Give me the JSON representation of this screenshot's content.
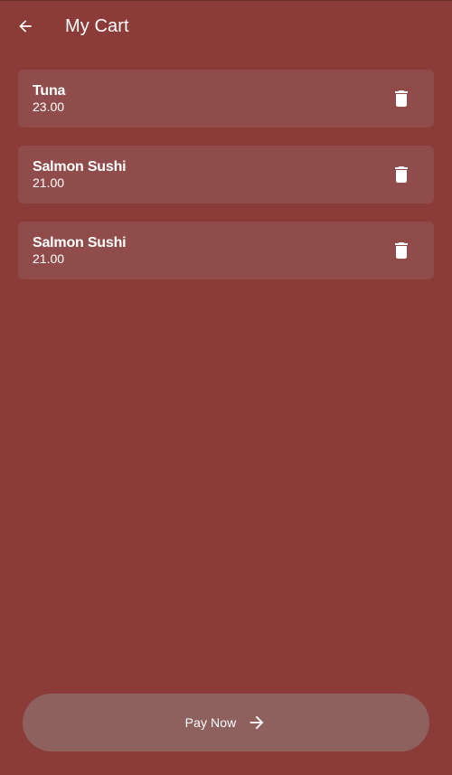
{
  "header": {
    "title": "My Cart",
    "back_icon": "arrow-back-icon"
  },
  "cart": {
    "items": [
      {
        "name": "Tuna",
        "price": "23.00",
        "action_icon": "trash-icon"
      },
      {
        "name": "Salmon Sushi",
        "price": "21.00",
        "action_icon": "trash-icon"
      },
      {
        "name": "Salmon Sushi",
        "price": "21.00",
        "action_icon": "trash-icon"
      }
    ]
  },
  "footer": {
    "pay_label": "Pay Now",
    "pay_icon": "arrow-forward-icon"
  },
  "colors": {
    "background": "#8b3c38",
    "card": "#8f4c4a",
    "pay_button": "#8e605e",
    "text": "#ffffff"
  }
}
